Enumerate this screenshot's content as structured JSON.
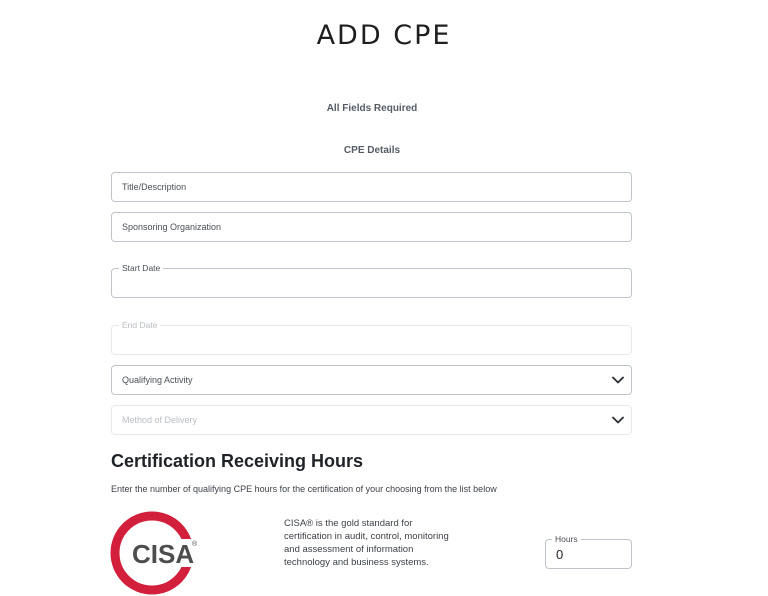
{
  "header": {
    "title": "ADD CPE"
  },
  "form": {
    "required_note": "All Fields Required",
    "section_label": "CPE Details",
    "title_placeholder": "Title/Description",
    "sponsor_placeholder": "Sponsoring Organization",
    "start_date_label": "Start Date",
    "end_date_label": "End Date",
    "qualifying_activity_label": "Qualifying Activity",
    "delivery_method_label": "Method of Delivery"
  },
  "certification": {
    "heading": "Certification Receiving Hours",
    "description": "Enter the number of qualifying CPE hours for the certification of your choosing from the list below",
    "items": [
      {
        "logo_text": "CISA",
        "logo_mark": "®",
        "blurb": "CISA® is the gold standard for certification in audit, control, monitoring and assessment of information technology and business systems.",
        "hours_label": "Hours",
        "hours_value": "0"
      }
    ]
  },
  "colors": {
    "cisa_red": "#d21f3c",
    "cisa_gray": "#4d4d4f",
    "border": "#bfc4cb"
  },
  "icons": {
    "dropdown": "chevron-down-icon"
  }
}
